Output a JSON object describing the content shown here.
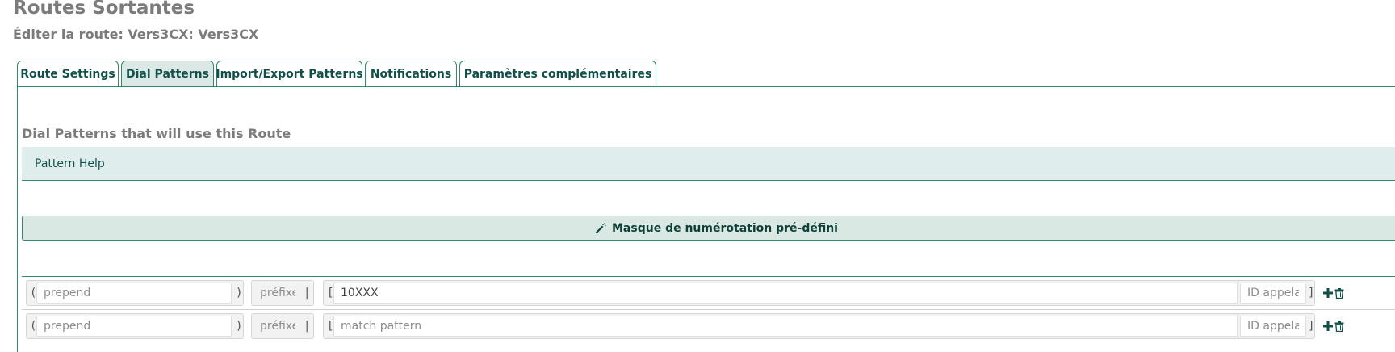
{
  "page": {
    "title": "Routes Sortantes",
    "subtitle": "Éditer la route: Vers3CX: Vers3CX"
  },
  "tabs": [
    {
      "label": "Route Settings",
      "active": false
    },
    {
      "label": "Dial Patterns",
      "active": true
    },
    {
      "label": "Import/Export Patterns",
      "active": false
    },
    {
      "label": "Notifications",
      "active": false
    },
    {
      "label": "Paramètres complémentaires",
      "active": false
    }
  ],
  "section": {
    "heading": "Dial Patterns that will use this Route",
    "help_label": "Pattern Help",
    "predefined_label": "Masque de numérotation pré-défini"
  },
  "pattern_rows": [
    {
      "prepend_open": "(",
      "prepend_value": "",
      "prepend_placeholder": "prepend",
      "prepend_close": ")",
      "prefix_value": "",
      "prefix_placeholder": "préfixe",
      "prefix_sep": "|",
      "match_open": "[",
      "match_value": "10XXX",
      "match_placeholder": "match pattern",
      "match_slash": "/",
      "cid_value": "",
      "cid_placeholder": "ID appelant",
      "cid_close": "]"
    },
    {
      "prepend_open": "(",
      "prepend_value": "",
      "prepend_placeholder": "prepend",
      "prepend_close": ")",
      "prefix_value": "",
      "prefix_placeholder": "préfixe",
      "prefix_sep": "|",
      "match_open": "[",
      "match_value": "",
      "match_placeholder": "match pattern",
      "match_slash": "/",
      "cid_value": "",
      "cid_placeholder": "ID appelant",
      "cid_close": "]"
    }
  ],
  "icons": {
    "wand": "magic-wand-icon",
    "add": "plus-icon",
    "delete": "trash-icon"
  },
  "colors": {
    "accent": "#2e8b6c",
    "tab_text": "#11504a",
    "active_tab_bg": "#dce8e6",
    "help_bg": "#dfeeed",
    "button_bg": "#d9e8e2",
    "heading_gray": "#7b7b7b"
  }
}
